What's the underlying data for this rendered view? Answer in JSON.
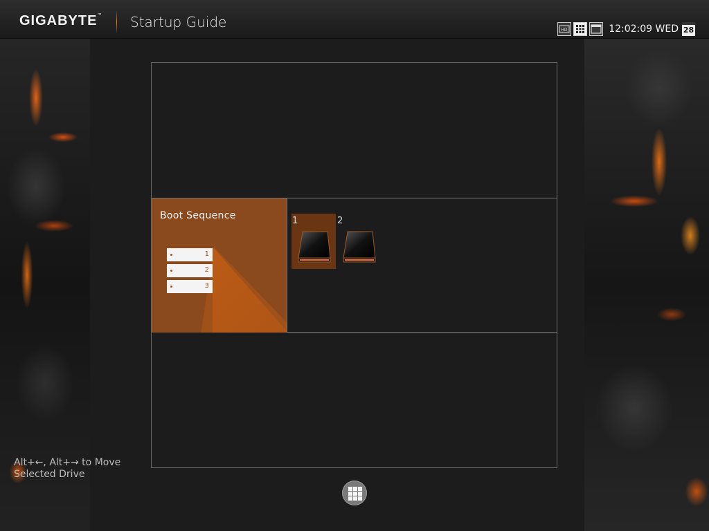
{
  "header": {
    "brand": "GIGABYTE",
    "brand_mark": "™",
    "app_title": "Startup Guide",
    "tray_icons": [
      "hd-icon",
      "grid-view-icon",
      "window-view-icon"
    ],
    "clock": "12:02:09 WED",
    "date_day": "28"
  },
  "boot_tile": {
    "title": "Boot Sequence",
    "list": [
      "1",
      "2",
      "3"
    ]
  },
  "drives": [
    {
      "number": "1",
      "selected": true,
      "icon": "drive-icon"
    },
    {
      "number": "2",
      "selected": false,
      "icon": "drive-icon"
    }
  ],
  "hint": {
    "line1": "Alt+←, Alt+→ to Move",
    "line2": "Selected Drive"
  },
  "footer": {
    "home_icon": "apps-grid-icon"
  },
  "colors": {
    "accent": "#8a4a1e",
    "accent_glow": "#ff7a1a",
    "background": "#1c1c1c"
  }
}
